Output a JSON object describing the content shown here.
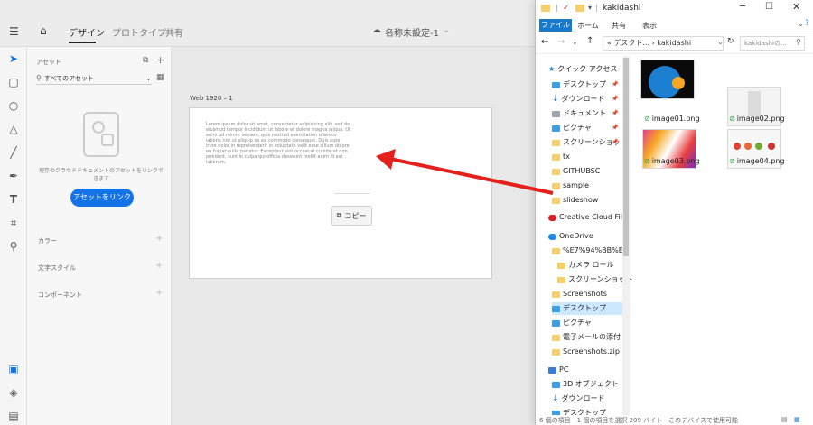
{
  "xd": {
    "tabs": [
      "デザイン",
      "プロトタイプ",
      "共有"
    ],
    "doc_title": "名称未設定-1",
    "assets_label": "アセット",
    "assets_filter": "すべてのアセット",
    "empty_message": "現存のクラウドドキュメントのアセットをリンクできます",
    "link_button": "アセットをリンク",
    "sections": [
      "カラー",
      "文字スタイル",
      "コンポーネント"
    ],
    "artboard_label": "Web 1920 – 1",
    "lorem": "Lorem ipsum dolor sit amet, consectetur adipisicing elit, sed do eiusmod tempor incididunt ut labore et dolore magna aliqua. Ut enim ad minim veniam, quis nostrud exercitation ullamco laboris nisi ut aliquip ex ea commodo consequat. Duis aute irure dolor in reprehenderit in voluptate velit esse cillum dolore eu fugiat nulla pariatur. Excepteur sint occaecat cupidatat non proident, sunt in culpa qui officia deserunt mollit anim id est laborum.",
    "copy_button": "コピー"
  },
  "explorer": {
    "title": "kakidashi",
    "ribbon_tabs": [
      "ファイル",
      "ホーム",
      "共有",
      "表示"
    ],
    "address": "« デスクト... › kakidashi",
    "search_placeholder": "kakidashiの...",
    "nav_items": [
      {
        "label": "クイック アクセス",
        "icon": "star"
      },
      {
        "label": "デスクトップ",
        "icon": "blue"
      },
      {
        "label": "ダウンロード",
        "icon": "blue"
      },
      {
        "label": "ドキュメント",
        "icon": "gray"
      },
      {
        "label": "ピクチャ",
        "icon": "blue"
      },
      {
        "label": "スクリーンショッ",
        "icon": "folder"
      },
      {
        "label": "tx",
        "icon": "folder"
      },
      {
        "label": "GITHUBSC",
        "icon": "folder"
      },
      {
        "label": "sample",
        "icon": "folder"
      },
      {
        "label": "slideshow",
        "icon": "folder"
      },
      {
        "label": "Creative Cloud File",
        "icon": "cloud"
      },
      {
        "label": "OneDrive",
        "icon": "cloud"
      },
      {
        "label": "%E7%94%BB%E5",
        "icon": "folder"
      },
      {
        "label": "カメラ ロール",
        "icon": "folder"
      },
      {
        "label": "スクリーンショット",
        "icon": "folder"
      },
      {
        "label": "Screenshots",
        "icon": "folder"
      },
      {
        "label": "デスクトップ",
        "icon": "blue"
      },
      {
        "label": "ピクチャ",
        "icon": "blue"
      },
      {
        "label": "電子メールの添付",
        "icon": "folder"
      },
      {
        "label": "Screenshots.zip",
        "icon": "folder"
      },
      {
        "label": "PC",
        "icon": "pc"
      },
      {
        "label": "3D オブジェクト",
        "icon": "blue"
      },
      {
        "label": "ダウンロード",
        "icon": "blue"
      },
      {
        "label": "デスクトップ",
        "icon": "blue"
      }
    ],
    "files": [
      "image01.png",
      "image02.png",
      "image03.png",
      "image04.png"
    ],
    "status": "6 個の項目　1 個の項目を選択 209 バイト　このデバイスで使用可能"
  }
}
